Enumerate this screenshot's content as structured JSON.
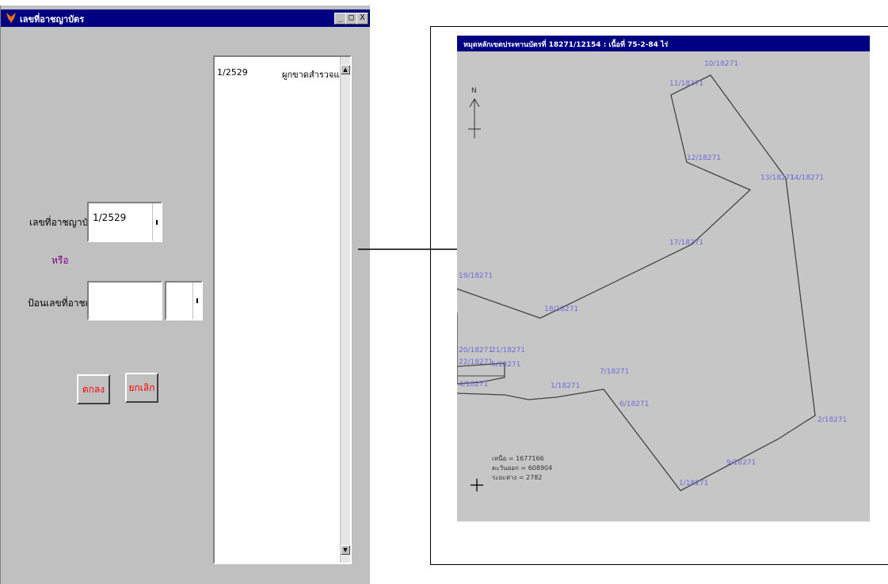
{
  "dialog": {
    "title": "เลขที่อาชญาบัตร",
    "window_buttons": {
      "minimize": "_",
      "maximize": "□",
      "close": "X"
    },
    "permit_label": "เลขที่อาชญาบัตร",
    "permit_value": "1/2529",
    "or_label": "หรือ",
    "enter_label": "ป้อนเลขที่อาชญาบัตร",
    "enter_value": "",
    "ok_button": "ตกลง",
    "cancel_button": "ยกเลิก"
  },
  "list": {
    "rows": [
      {
        "permit": "1/2529",
        "desc": "ผูกขาดสำรวจแร่"
      }
    ]
  },
  "map": {
    "title": "หมุดหลักเขตประทานบัตรที่ 18271/12154 : เนื้อที่ 75-2-84 ไร่",
    "north": "N",
    "points": [
      {
        "label": "10/18271"
      },
      {
        "label": "11/18271"
      },
      {
        "label": "12/18271"
      },
      {
        "label": "13/18271"
      },
      {
        "label": "14/18271"
      },
      {
        "label": "17/18271"
      },
      {
        "label": "19/18271"
      },
      {
        "label": "18/18271"
      },
      {
        "label": "20/18271"
      },
      {
        "label": "21/18271"
      },
      {
        "label": "22/18271"
      },
      {
        "label": "5/18271"
      },
      {
        "label": "4/18271"
      },
      {
        "label": "7/18271"
      },
      {
        "label": "6/18271"
      },
      {
        "label": "1/18271"
      },
      {
        "label": "2/18271"
      },
      {
        "label": "9/18271"
      },
      {
        "label": "1/18271"
      }
    ],
    "info": {
      "line1": "เหนือ = 1677166",
      "line2": "ตะวันออก = 608904",
      "line3": "ระยะห่าง = 2782"
    }
  },
  "colors": {
    "titlebar": "#000080",
    "window_bg": "#c0c0c0",
    "button_text": "#ff0000",
    "or_text": "#800080",
    "point_label": "#6b6bd6"
  }
}
